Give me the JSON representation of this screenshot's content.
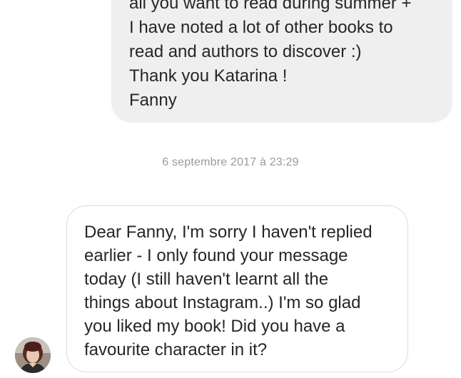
{
  "conversation": {
    "outgoing_message": {
      "lines": [
        "all you want to read during summer +",
        "I have noted a lot of other books to",
        "read and authors to discover :)",
        "Thank you Katarina !",
        "Fanny"
      ]
    },
    "timestamp": "6 septembre 2017 à 23:29",
    "incoming_message": {
      "lines": [
        "Dear Fanny, I'm sorry I haven't replied",
        "earlier - I only found your message",
        "today (I still haven't learnt all the",
        "things about Instagram..) I'm so glad",
        "you liked my book! Did you have a",
        "favourite character in it?"
      ]
    }
  },
  "colors": {
    "outgoing_bubble": "#efefef",
    "incoming_border": "#dbdbdb",
    "text": "#262626",
    "timestamp": "#999999"
  },
  "icons": {
    "avatar": "sender-avatar-photo"
  }
}
